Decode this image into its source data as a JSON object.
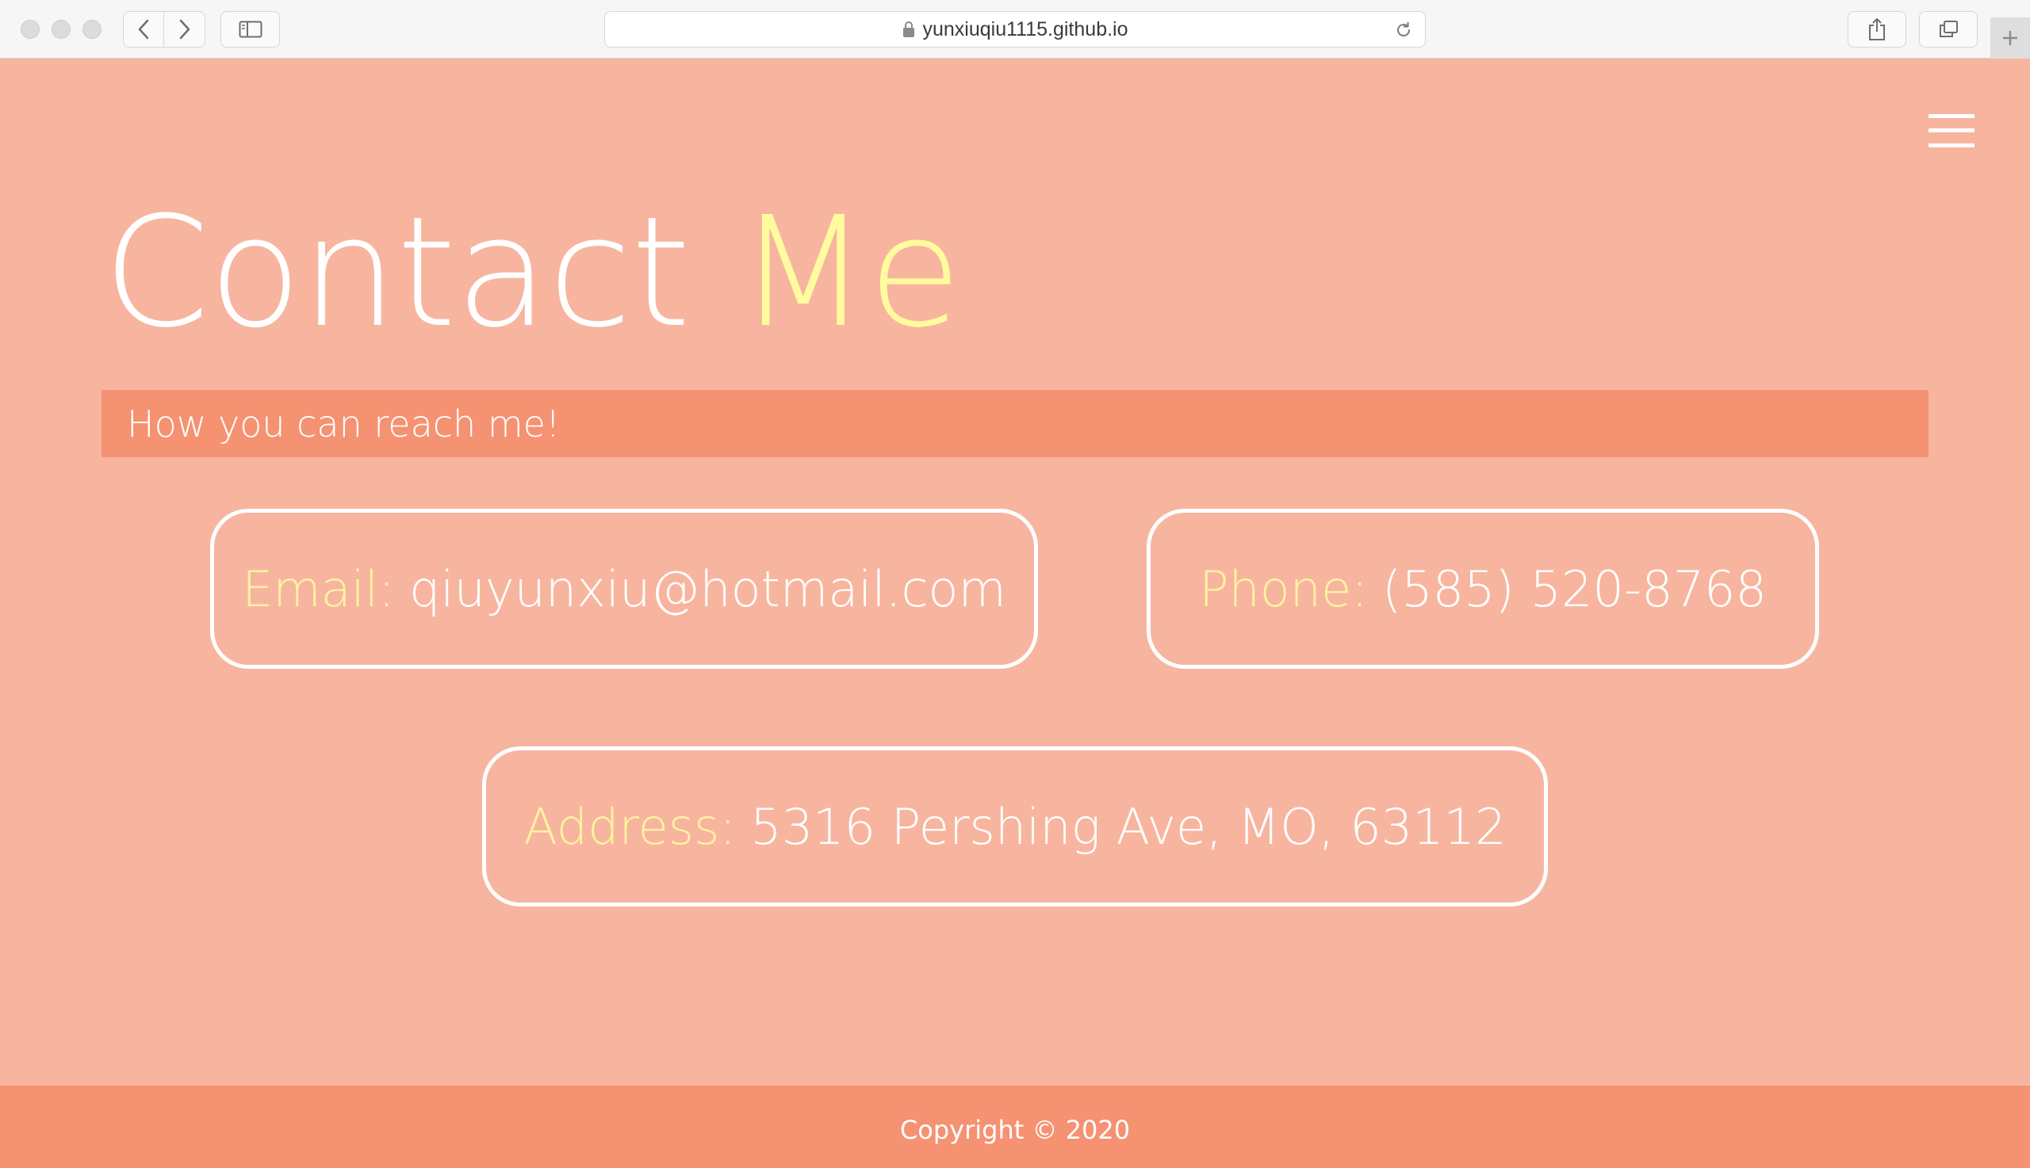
{
  "browser": {
    "url": "yunxiuqiu1115.github.io",
    "icons": {
      "back": "chevron-left-icon",
      "forward": "chevron-right-icon",
      "sidebar": "sidebar-icon",
      "lock": "lock-icon",
      "reload": "reload-icon",
      "share": "share-icon",
      "tabs": "tabs-overview-icon",
      "new_tab": "plus-icon"
    }
  },
  "header": {
    "menu_icon": "hamburger-menu-icon"
  },
  "hero": {
    "title_part1": "Contact",
    "title_part2": "Me",
    "subtitle": "How you can reach me!"
  },
  "contact": {
    "email": {
      "label": "Email:",
      "value": "qiuyunxiu@hotmail.com"
    },
    "phone": {
      "label": "Phone:",
      "value": "(585) 520-8768"
    },
    "address": {
      "label": "Address:",
      "value": "5316 Pershing Ave, MO, 63112"
    }
  },
  "footer": {
    "copyright": "Copyright © 2020"
  },
  "colors": {
    "page_background": "#f7b59f",
    "bar_background": "#f59272",
    "accent_text": "#fffb9e",
    "text": "#ffffff"
  }
}
